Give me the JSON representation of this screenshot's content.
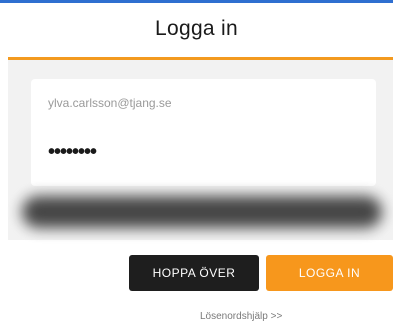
{
  "header": {
    "title": "Logga in"
  },
  "form": {
    "email_value": "ylva.carlsson@tjang.se",
    "password_mask": "••••••••"
  },
  "actions": {
    "skip_label": "HOPPA ÖVER",
    "login_label": "LOGGA IN"
  },
  "links": {
    "forgot_password": "Lösenordshjälp >>"
  },
  "colors": {
    "accent": "#f7971c",
    "dark_button": "#1e1e1e",
    "panel_background": "#f2f2f2",
    "top_strip": "#2f6fd0"
  }
}
